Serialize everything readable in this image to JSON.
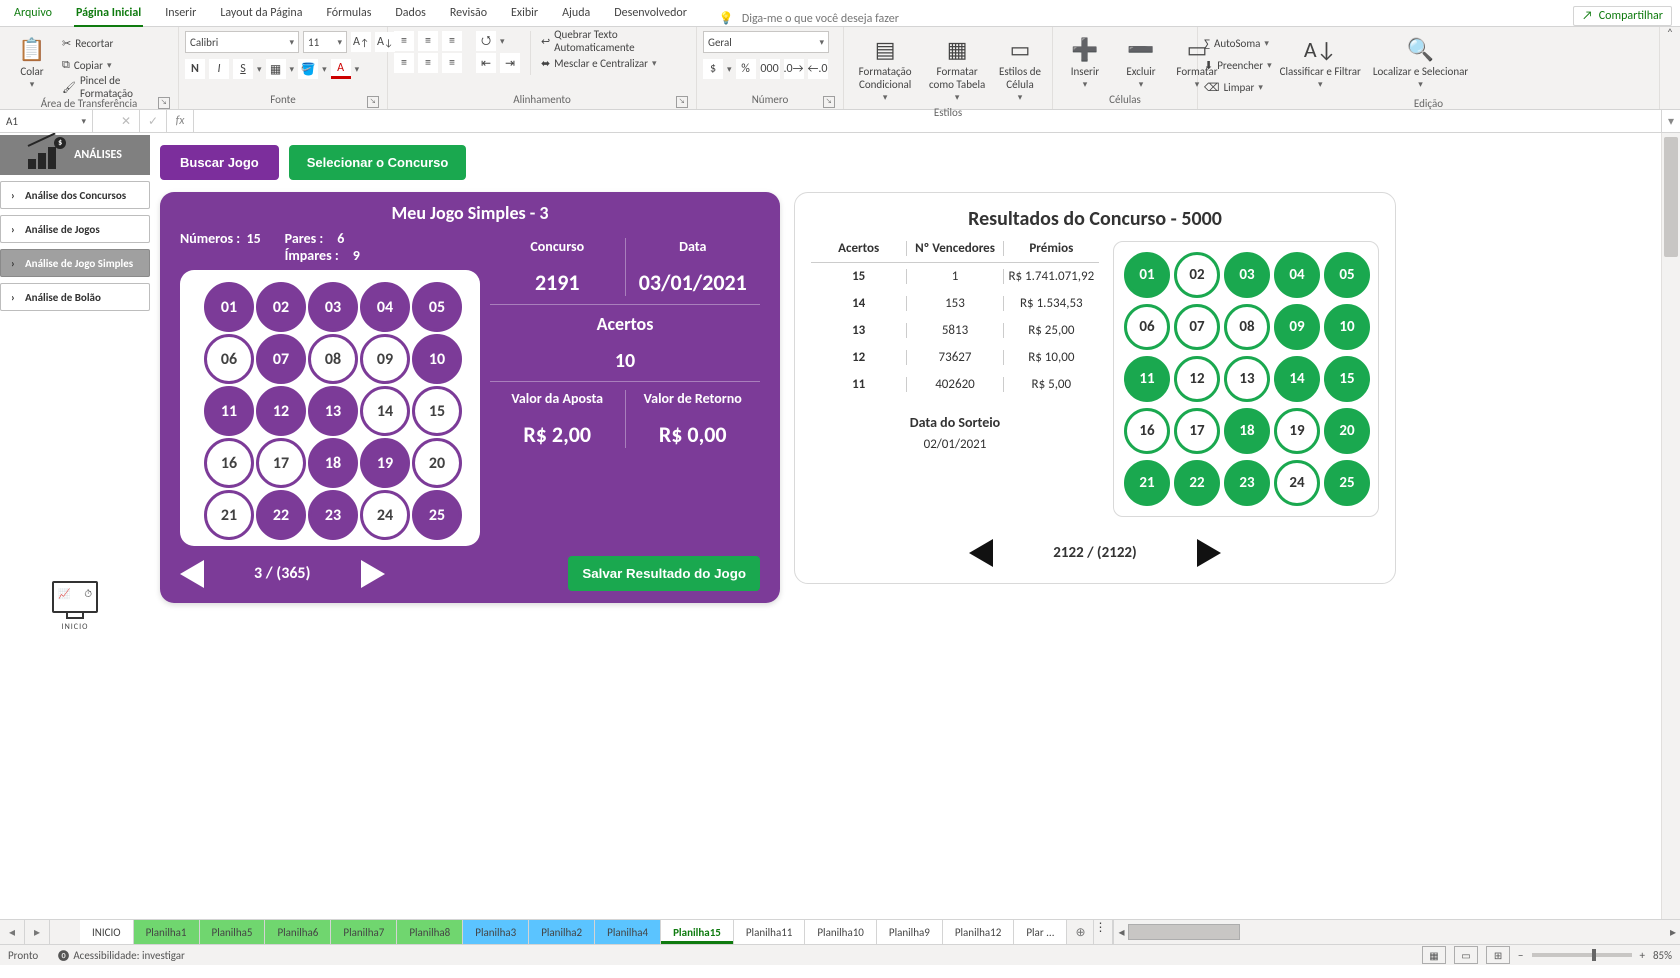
{
  "menu": {
    "arquivo": "Arquivo",
    "inicio": "Página Inicial",
    "inserir": "Inserir",
    "layout": "Layout da Página",
    "formulas": "Fórmulas",
    "dados": "Dados",
    "revisao": "Revisão",
    "exibir": "Exibir",
    "ajuda": "Ajuda",
    "dev": "Desenvolvedor",
    "tellme": "Diga-me o que você deseja fazer",
    "share": "Compartilhar"
  },
  "ribbon": {
    "clipboard": {
      "paste": "Colar",
      "cut": "Recortar",
      "copy": "Copiar",
      "painter": "Pincel de Formatação",
      "label": "Área de Transferência"
    },
    "font": {
      "name": "Calibri",
      "size": "11",
      "label": "Fonte"
    },
    "align": {
      "wrap": "Quebrar Texto Automaticamente",
      "merge": "Mesclar e Centralizar",
      "label": "Alinhamento"
    },
    "number": {
      "format": "Geral",
      "label": "Número"
    },
    "styles": {
      "cond": "Formatação Condicional",
      "table": "Formatar como Tabela",
      "cell": "Estilos de Célula",
      "label": "Estilos"
    },
    "cells": {
      "insert": "Inserir",
      "delete": "Excluir",
      "format": "Formatar",
      "label": "Células"
    },
    "editing": {
      "sum": "AutoSoma",
      "fill": "Preencher",
      "clear": "Limpar",
      "sort": "Classificar e Filtrar",
      "find": "Localizar e Selecionar",
      "label": "Edição"
    }
  },
  "fbar": {
    "cell": "A1",
    "fx": "fx"
  },
  "sidebar": {
    "title": "ANÁLISES",
    "items": [
      "Análise dos Concursos",
      "Análise de Jogos",
      "Análise de Jogo Simples",
      "Análise de Bolão"
    ],
    "home": "INICIO"
  },
  "topbtn": {
    "buscar": "Buscar Jogo",
    "selec": "Selecionar o Concurso"
  },
  "game": {
    "title": "Meu Jogo Simples - 3",
    "numeros_lbl": "Números :",
    "numeros": "15",
    "pares_lbl": "Pares :",
    "pares": "6",
    "impares_lbl": "Ímpares :",
    "impares": "9",
    "balls": [
      {
        "n": "01",
        "s": 1
      },
      {
        "n": "02",
        "s": 1
      },
      {
        "n": "03",
        "s": 1
      },
      {
        "n": "04",
        "s": 1
      },
      {
        "n": "05",
        "s": 1
      },
      {
        "n": "06",
        "s": 0
      },
      {
        "n": "07",
        "s": 1
      },
      {
        "n": "08",
        "s": 0
      },
      {
        "n": "09",
        "s": 0
      },
      {
        "n": "10",
        "s": 1
      },
      {
        "n": "11",
        "s": 1
      },
      {
        "n": "12",
        "s": 1
      },
      {
        "n": "13",
        "s": 1
      },
      {
        "n": "14",
        "s": 0
      },
      {
        "n": "15",
        "s": 0
      },
      {
        "n": "16",
        "s": 0
      },
      {
        "n": "17",
        "s": 0
      },
      {
        "n": "18",
        "s": 1
      },
      {
        "n": "19",
        "s": 1
      },
      {
        "n": "20",
        "s": 0
      },
      {
        "n": "21",
        "s": 0
      },
      {
        "n": "22",
        "s": 1
      },
      {
        "n": "23",
        "s": 1
      },
      {
        "n": "24",
        "s": 0
      },
      {
        "n": "25",
        "s": 1
      }
    ],
    "concurso_lbl": "Concurso",
    "concurso": "2191",
    "data_lbl": "Data",
    "data": "03/01/2021",
    "acertos_lbl": "Acertos",
    "acertos": "10",
    "aposta_lbl": "Valor da Aposta",
    "aposta": "R$ 2,00",
    "retorno_lbl": "Valor de Retorno",
    "retorno": "R$ 0,00",
    "page": "3 / (365)",
    "save": "Salvar Resultado do Jogo"
  },
  "result": {
    "title": "Resultados do Concurso - 5000",
    "h": {
      "acertos": "Acertos",
      "venc": "Nº Vencedores",
      "premios": "Prémios"
    },
    "rows": [
      {
        "a": "15",
        "v": "1",
        "p": "R$ 1.741.071,92"
      },
      {
        "a": "14",
        "v": "153",
        "p": "R$ 1.534,53"
      },
      {
        "a": "13",
        "v": "5813",
        "p": "R$ 25,00"
      },
      {
        "a": "12",
        "v": "73627",
        "p": "R$ 10,00"
      },
      {
        "a": "11",
        "v": "402620",
        "p": "R$ 5,00"
      }
    ],
    "date_lbl": "Data do Sorteio",
    "date": "02/01/2021",
    "balls": [
      {
        "n": "01",
        "s": 1
      },
      {
        "n": "02",
        "s": 0
      },
      {
        "n": "03",
        "s": 1
      },
      {
        "n": "04",
        "s": 1
      },
      {
        "n": "05",
        "s": 1
      },
      {
        "n": "06",
        "s": 0
      },
      {
        "n": "07",
        "s": 0
      },
      {
        "n": "08",
        "s": 0
      },
      {
        "n": "09",
        "s": 1
      },
      {
        "n": "10",
        "s": 1
      },
      {
        "n": "11",
        "s": 1
      },
      {
        "n": "12",
        "s": 0
      },
      {
        "n": "13",
        "s": 0
      },
      {
        "n": "14",
        "s": 1
      },
      {
        "n": "15",
        "s": 1
      },
      {
        "n": "16",
        "s": 0
      },
      {
        "n": "17",
        "s": 0
      },
      {
        "n": "18",
        "s": 1
      },
      {
        "n": "19",
        "s": 0
      },
      {
        "n": "20",
        "s": 1
      },
      {
        "n": "21",
        "s": 1
      },
      {
        "n": "22",
        "s": 1
      },
      {
        "n": "23",
        "s": 1
      },
      {
        "n": "24",
        "s": 0
      },
      {
        "n": "25",
        "s": 1
      }
    ],
    "page": "2122 / (2122)"
  },
  "sheets": [
    "INICIO",
    "Planilha1",
    "Planilha5",
    "Planilha6",
    "Planilha7",
    "Planilha8",
    "Planilha3",
    "Planilha2",
    "Planilha4",
    "Planilha15",
    "Planilha11",
    "Planilha10",
    "Planilha9",
    "Planilha12",
    "Plar  ..."
  ],
  "sheet_active": 9,
  "sheet_colors": [
    "",
    "g",
    "g",
    "g",
    "g",
    "g",
    "b",
    "b",
    "b",
    "act",
    "",
    "",
    "",
    "",
    ""
  ],
  "status": {
    "ready": "Pronto",
    "acc": "Acessibilidade: investigar",
    "zoom": "85%"
  }
}
